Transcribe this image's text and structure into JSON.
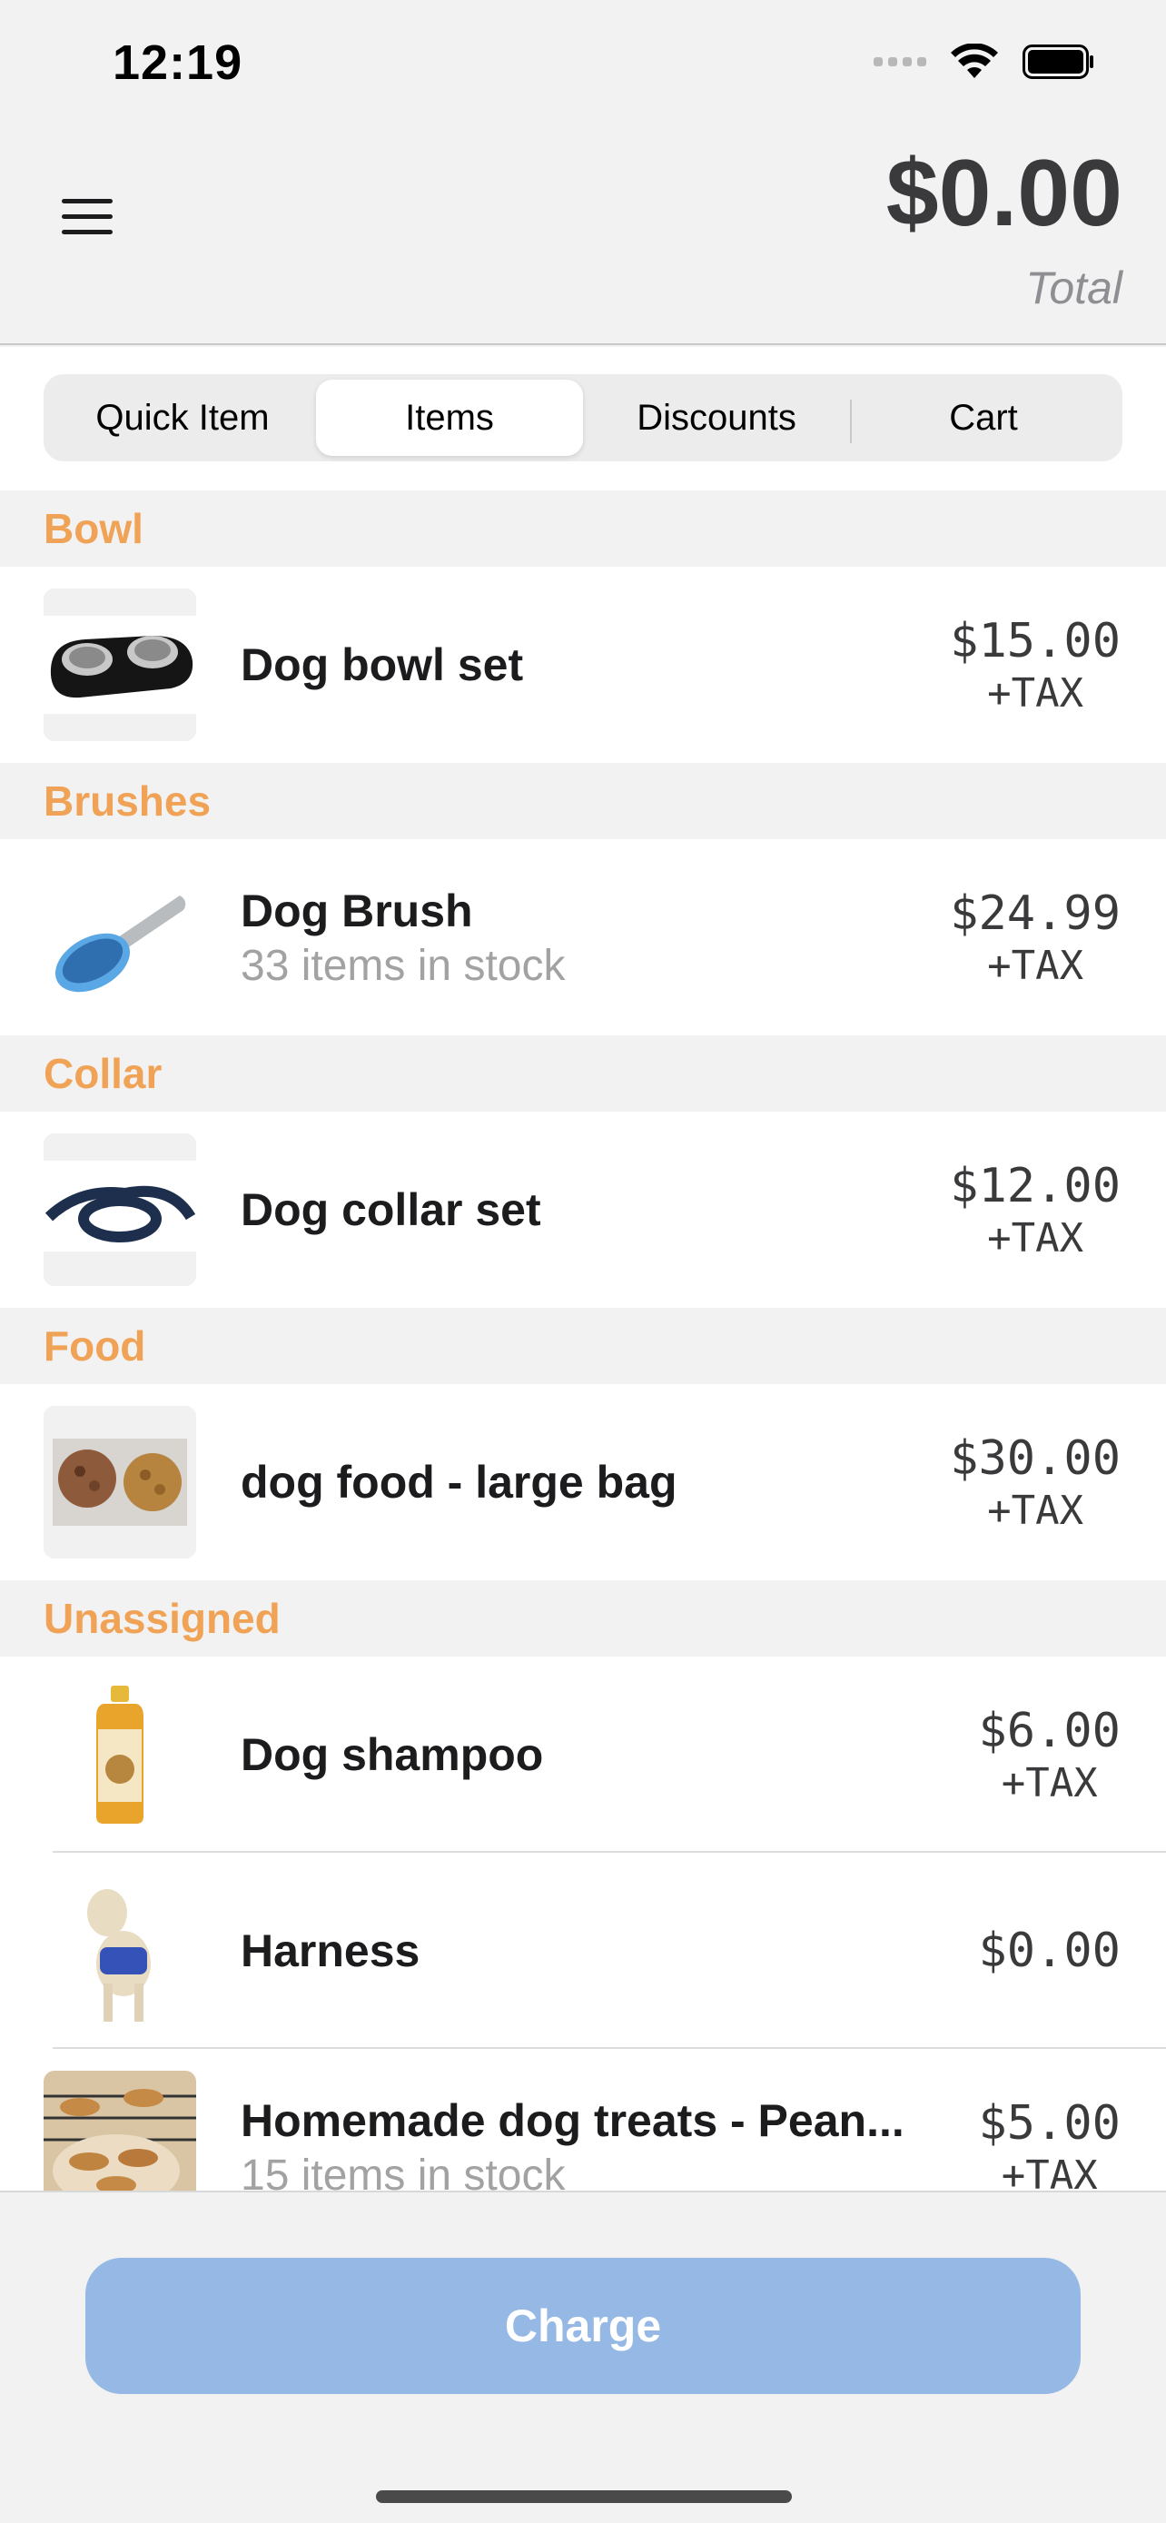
{
  "status_bar": {
    "time": "12:19"
  },
  "header": {
    "total_amount": "$0.00",
    "total_label": "Total"
  },
  "tabs": [
    {
      "label": "Quick Item",
      "active": false
    },
    {
      "label": "Items",
      "active": true
    },
    {
      "label": "Discounts",
      "active": false
    },
    {
      "label": "Cart",
      "active": false
    }
  ],
  "sections": [
    {
      "title": "Bowl",
      "items": [
        {
          "name": "Dog bowl set",
          "stock": "",
          "price": "$15.00",
          "tax": "+TAX",
          "image": "dog-bowl-image"
        }
      ]
    },
    {
      "title": "Brushes",
      "items": [
        {
          "name": "Dog Brush",
          "stock": "33 items in stock",
          "price": "$24.99",
          "tax": "+TAX",
          "image": "dog-brush-image"
        }
      ]
    },
    {
      "title": "Collar",
      "items": [
        {
          "name": "Dog collar set",
          "stock": "",
          "price": "$12.00",
          "tax": "+TAX",
          "image": "dog-collar-image"
        }
      ]
    },
    {
      "title": "Food",
      "items": [
        {
          "name": "dog food - large bag",
          "stock": "",
          "price": "$30.00",
          "tax": "+TAX",
          "image": "dog-food-image"
        }
      ]
    },
    {
      "title": "Unassigned",
      "items": [
        {
          "name": "Dog shampoo",
          "stock": "",
          "price": "$6.00",
          "tax": "+TAX",
          "image": "dog-shampoo-image"
        },
        {
          "name": "Harness",
          "stock": "",
          "price": "$0.00",
          "tax": "",
          "image": "harness-image"
        },
        {
          "name": "Homemade dog treats - Pean...",
          "stock": "15 items in stock",
          "price": "$5.00",
          "tax": "+TAX",
          "image": "dog-treats-image"
        }
      ]
    }
  ],
  "footer": {
    "charge_label": "Charge"
  },
  "colors": {
    "section_header": "#f0a356",
    "charge_button": "#95b8e4",
    "background": "#f2f2f2"
  }
}
